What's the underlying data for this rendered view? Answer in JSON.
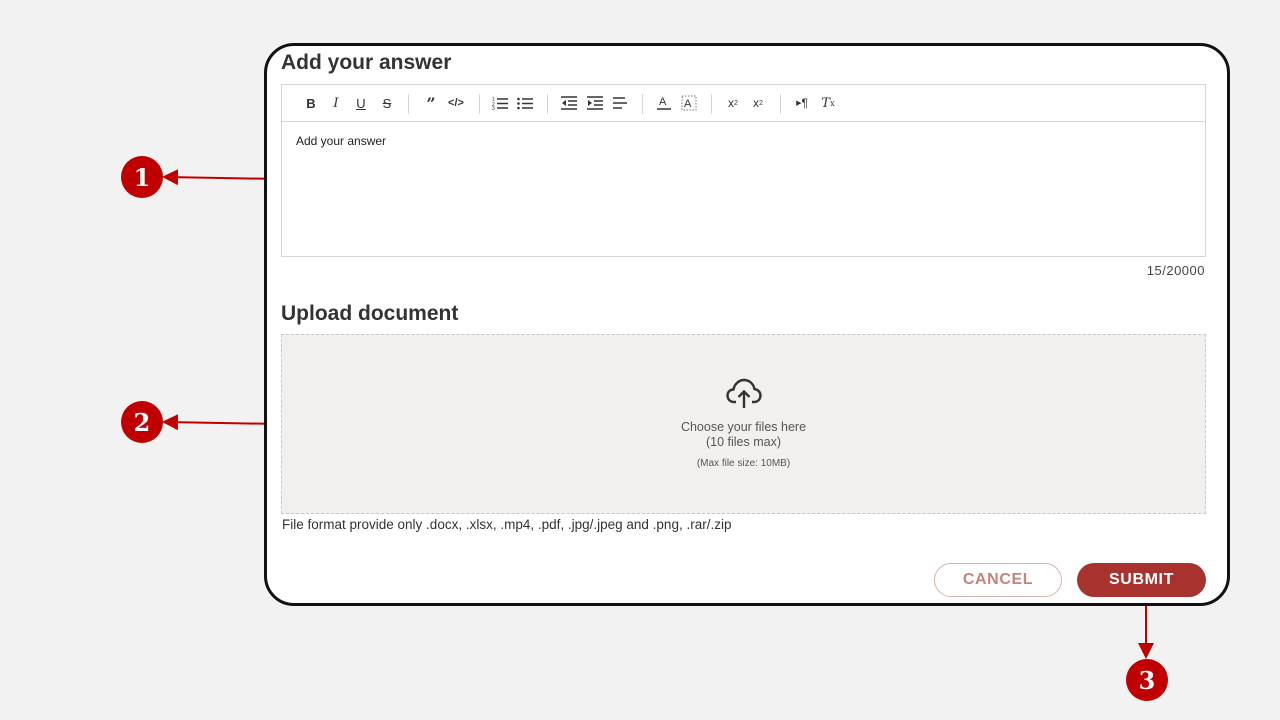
{
  "answer": {
    "heading": "Add your answer",
    "content": "Add your answer",
    "counter": "15/20000"
  },
  "toolbar": {
    "icons": [
      "bold-icon",
      "italic-icon",
      "underline-icon",
      "strikethrough-icon",
      "blockquote-icon",
      "code-icon",
      "ordered-list-icon",
      "bullet-list-icon",
      "outdent-icon",
      "indent-icon",
      "align-left-icon",
      "text-color-icon",
      "background-color-icon",
      "subscript-icon",
      "superscript-icon",
      "text-direction-icon",
      "clear-format-icon"
    ]
  },
  "upload": {
    "heading": "Upload document",
    "line1": "Choose your files here",
    "line2": "(10 files max)",
    "line3": "(Max file size: 10MB)",
    "formats": "File format provide only .docx, .xlsx, .mp4, .pdf, .jpg/.jpeg and .png, .rar/.zip",
    "icon": "cloud-upload-icon"
  },
  "buttons": {
    "cancel": "CANCEL",
    "submit": "SUBMIT"
  },
  "annotations": {
    "one": "1",
    "two": "2",
    "three": "3"
  },
  "colors": {
    "accent": "#a8322d",
    "annotation": "#c00000"
  }
}
